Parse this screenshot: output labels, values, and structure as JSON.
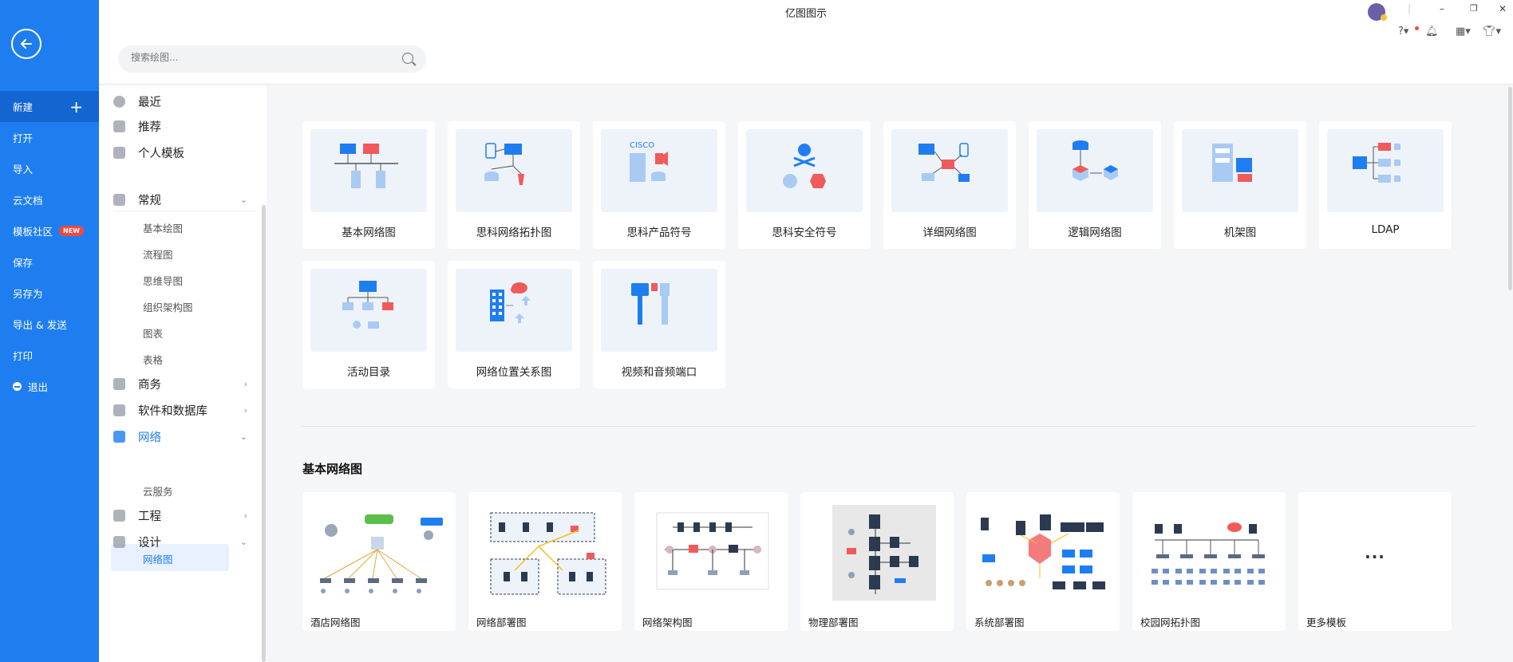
{
  "window": {
    "title": "亿图图示",
    "controls": [
      "minimize",
      "restore",
      "close"
    ]
  },
  "header": {
    "search_placeholder": "搜索绘图..."
  },
  "left_menu": {
    "items": [
      {
        "label": "新建",
        "icon": "plus-icon",
        "active": true
      },
      {
        "label": "打开"
      },
      {
        "label": "导入"
      },
      {
        "label": "云文档"
      },
      {
        "label": "模板社区",
        "badge": "NEW"
      },
      {
        "label": "保存"
      },
      {
        "label": "另存为"
      },
      {
        "label": "导出 & 发送"
      },
      {
        "label": "打印"
      },
      {
        "label": "退出",
        "icon": "exit-icon"
      }
    ]
  },
  "categories": {
    "top": [
      {
        "label": "最近",
        "icon": "clock-icon"
      },
      {
        "label": "推荐",
        "icon": "star-icon"
      },
      {
        "label": "个人模板",
        "icon": "template-icon"
      }
    ],
    "groups": [
      {
        "label": "常规",
        "expanded": true,
        "subs": [
          "基本绘图",
          "流程图",
          "思维导图",
          "组织架构图",
          "图表",
          "表格"
        ]
      },
      {
        "label": "商务",
        "expanded": false
      },
      {
        "label": "软件和数据库",
        "expanded": false
      },
      {
        "label": "网络",
        "expanded": true,
        "active": true,
        "subs": [
          "网络图",
          "云服务"
        ],
        "active_sub": "网络图"
      },
      {
        "label": "工程",
        "expanded": false
      },
      {
        "label": "设计",
        "expanded": true
      }
    ]
  },
  "diagram_types": [
    {
      "label": "基本网络图"
    },
    {
      "label": "思科网络拓扑图"
    },
    {
      "label": "思科产品符号",
      "thumb_text": "CISCO"
    },
    {
      "label": "思科安全符号"
    },
    {
      "label": "详细网络图"
    },
    {
      "label": "逻辑网络图"
    },
    {
      "label": "机架图"
    },
    {
      "label": "LDAP"
    },
    {
      "label": "活动目录"
    },
    {
      "label": "网络位置关系图"
    },
    {
      "label": "视频和音频端口"
    }
  ],
  "section": {
    "title": "基本网络图",
    "templates": [
      {
        "label": "酒店网络图"
      },
      {
        "label": "网络部署图"
      },
      {
        "label": "网络架构图"
      },
      {
        "label": "物理部署图"
      },
      {
        "label": "系统部署图"
      },
      {
        "label": "校园网拓扑图"
      },
      {
        "label": "更多模板",
        "more": "..."
      }
    ]
  },
  "colors": {
    "brand": "#1e7ef0",
    "accent_red": "#f15a5a"
  }
}
